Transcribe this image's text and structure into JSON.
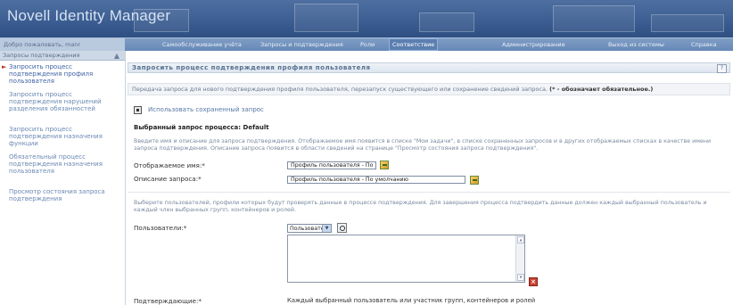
{
  "header": {
    "app_title": "Novell Identity Manager"
  },
  "nav": {
    "welcome": "Добро пожаловать, manr",
    "items": [
      {
        "label": "Самообслуживание учёта",
        "active": false
      },
      {
        "label": "Запросы и подтверждения",
        "active": false
      },
      {
        "label": "Роли",
        "active": false
      },
      {
        "label": "Соответствие",
        "active": true
      },
      {
        "label": "Администрирование",
        "active": false
      },
      {
        "label": "Выход из системы",
        "active": false
      },
      {
        "label": "Справка",
        "active": false
      }
    ]
  },
  "left_pane": {
    "header": "Запросы подтверждения",
    "items": [
      {
        "label": "Запросить процесс подтверждения профиля пользователя",
        "selected": true
      },
      {
        "label": "Запросить процесс подтверждения нарушений разделения обязанностей",
        "selected": false
      },
      {
        "label": "Запросить процесс подтверждения назначения функции",
        "selected": false
      },
      {
        "label": "Обязательный процесс подтверждения назначения пользователя",
        "selected": false
      },
      {
        "label": "Просмотр состояния запроса подтверждения",
        "selected": false
      }
    ]
  },
  "main": {
    "title": "Запросить процесс подтверждения профиля пользователя",
    "description": "Передача запроса для нового подтверждения профиля пользователя, перезапуск существующего или сохранение сведений запроса.",
    "required_note": "(* - обозначает обязательное.)",
    "use_saved_label": "Использовать сохраненный запрос",
    "selected_process": "Выбранный запрос процесса: Default",
    "instructions_1": "Введите имя и описание для запроса подтверждения. Отображаемое имя появится в списке \"Мои задачи\", в списке сохраненных запросов и в других отображаемых списках в качестве имени запроса подтверждения. Описание запроса появится в области сведений на странице \"Просмотр состояния запроса подтверждения\".",
    "display_name_label": "Отображаемое имя:*",
    "display_name_value": "Профиль пользователя - По умолчанию",
    "request_desc_label": "Описание запроса:*",
    "request_desc_value": "Профиль пользователя - По умолчанию",
    "instructions_2": "Выберите пользователей, профили которых будут проверять данные в процессе подтверждения. Для завершения процесса подтвердить данные должен каждый выбранный пользователь и каждый член выбранных групп, контейнеров и ролей.",
    "users_label": "Пользователи:*",
    "users_select_value": "Пользователь",
    "approvers_label": "Подтверждающие:*",
    "approvers_value": "Каждый выбранный пользователь или участник групп, контейнеров и ролей"
  },
  "icons": {
    "help": "help-icon",
    "saved_request": "saved-request-icon",
    "picker": "object-picker-icon",
    "search": "search-icon",
    "delete": "delete-icon"
  },
  "colors": {
    "banner": "#3c5e92",
    "nav_active": "#5c7fb0",
    "link": "#6b88b3",
    "delete": "#c94133"
  }
}
